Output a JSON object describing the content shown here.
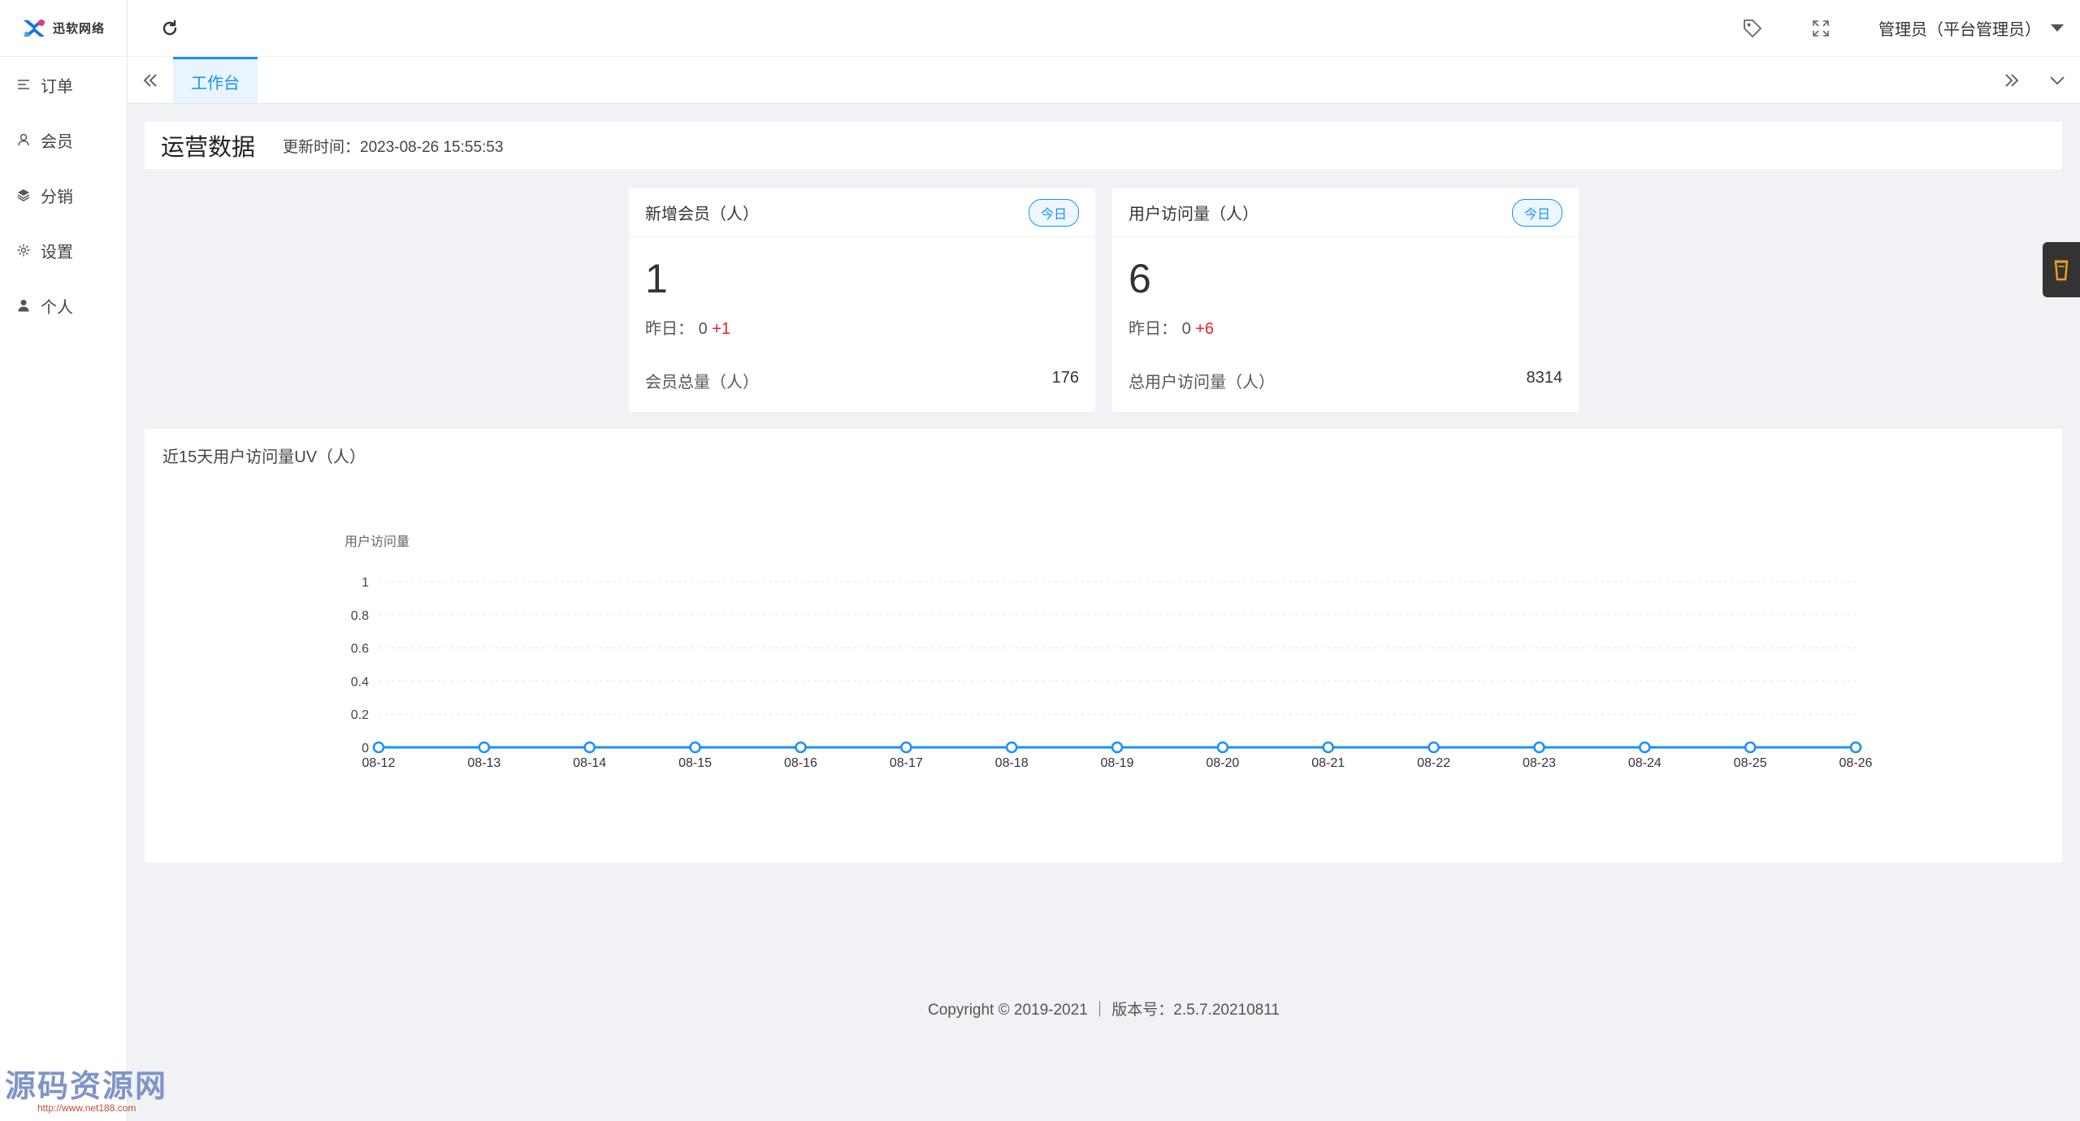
{
  "sidebar": {
    "logo_text": "迅软网络",
    "items": [
      {
        "label": "订单",
        "icon": "list-icon"
      },
      {
        "label": "会员",
        "icon": "user-icon"
      },
      {
        "label": "分销",
        "icon": "layers-icon"
      },
      {
        "label": "设置",
        "icon": "gear-icon"
      },
      {
        "label": "个人",
        "icon": "person-icon"
      }
    ]
  },
  "header": {
    "user_label": "管理员（平台管理员）"
  },
  "tabs": [
    {
      "label": "工作台",
      "active": true
    }
  ],
  "page": {
    "title": "运营数据",
    "updated": "更新时间：2023-08-26 15:55:53"
  },
  "cards": [
    {
      "label": "新增会员（人）",
      "badge": "今日",
      "value": "1",
      "yesterday_label": "昨日：",
      "yesterday_value": "0",
      "delta": "+1",
      "total_label": "会员总量（人）",
      "total_value": "176"
    },
    {
      "label": "用户访问量（人）",
      "badge": "今日",
      "value": "6",
      "yesterday_label": "昨日：",
      "yesterday_value": "0",
      "delta": "+6",
      "total_label": "总用户访问量（人）",
      "total_value": "8314"
    }
  ],
  "chart_data": {
    "type": "line",
    "title": "近15天用户访问量UV（人）",
    "ylabel": "用户访问量",
    "xlabel": "",
    "x": [
      "08-12",
      "08-13",
      "08-14",
      "08-15",
      "08-16",
      "08-17",
      "08-18",
      "08-19",
      "08-20",
      "08-21",
      "08-22",
      "08-23",
      "08-24",
      "08-25",
      "08-26"
    ],
    "series": [
      {
        "values": [
          0,
          0,
          0,
          0,
          0,
          0,
          0,
          0,
          0,
          0,
          0,
          0,
          0,
          0,
          0
        ]
      }
    ],
    "ylim": [
      0,
      1
    ],
    "yticks": [
      "0",
      "0.2",
      "0.4",
      "0.6",
      "0.8",
      "1"
    ],
    "grid": true,
    "color": "#1890ff"
  },
  "footer": {
    "text": "Copyright © 2019-2021 ｜ 版本号：2.5.7.20210811"
  },
  "watermark": {
    "main": "源码资源网",
    "sub": "http://www.net188.com"
  },
  "colors": {
    "accent": "#1890ff",
    "increase": "#e8202a"
  }
}
